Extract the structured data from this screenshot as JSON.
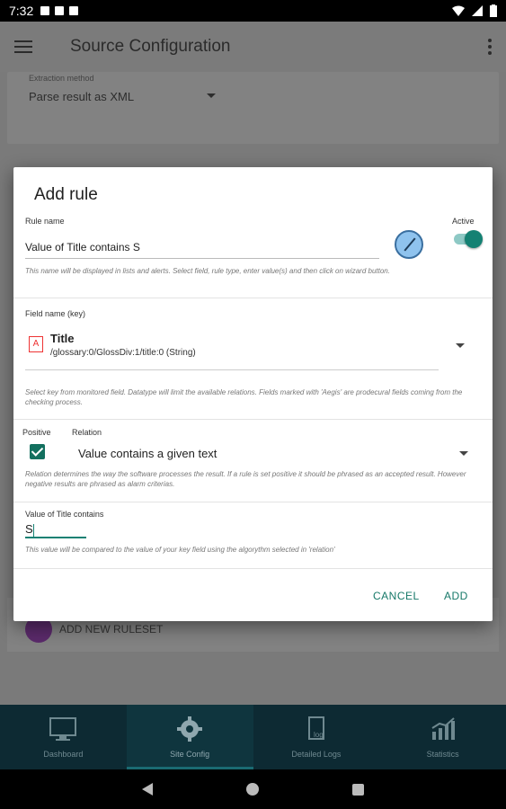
{
  "status_bar": {
    "time": "7:32"
  },
  "app_bar": {
    "title": "Source Configuration"
  },
  "background": {
    "extraction_label": "Extraction method",
    "extraction_value": "Parse result as XML",
    "add_ruleset": "ADD NEW RULESET"
  },
  "dialog": {
    "title": "Add rule",
    "rule_name_label": "Rule name",
    "rule_name_value": "Value of Title contains S",
    "active_label": "Active",
    "active": true,
    "rule_name_help": "This name will be displayed in lists and alerts. Select field, rule type, enter value(s) and then click on wizard button.",
    "field_name_label": "Field name (key)",
    "field_title": "Title",
    "field_path": "/glossary:0/GlossDiv:1/title:0 (String)",
    "field_help": "Select key from monitored field. Datatype will limit the available relations. Fields marked with 'Aegis' are prodecural fields coming from the checking process.",
    "positive_label": "Positive",
    "positive": true,
    "relation_label": "Relation",
    "relation_value": "Value contains a given text",
    "relation_help": "Relation determines the way the software processes the result. If a rule is set positive it should be phrased as an accepted result. However negative results are phrased as alarm criterias.",
    "value_label": "Value of Title contains",
    "value_value": "S",
    "value_help": "This value will be compared to the value of your key field using the algorythm selected in 'relation'",
    "cancel_label": "CANCEL",
    "add_label": "ADD"
  },
  "bottom_nav": {
    "items": [
      {
        "label": "Dashboard",
        "icon": "monitor-icon"
      },
      {
        "label": "Site Config",
        "icon": "gear-icon"
      },
      {
        "label": "Detailed Logs",
        "icon": "log-icon"
      },
      {
        "label": "Statistics",
        "icon": "chart-icon"
      }
    ],
    "active": "Site Config"
  }
}
